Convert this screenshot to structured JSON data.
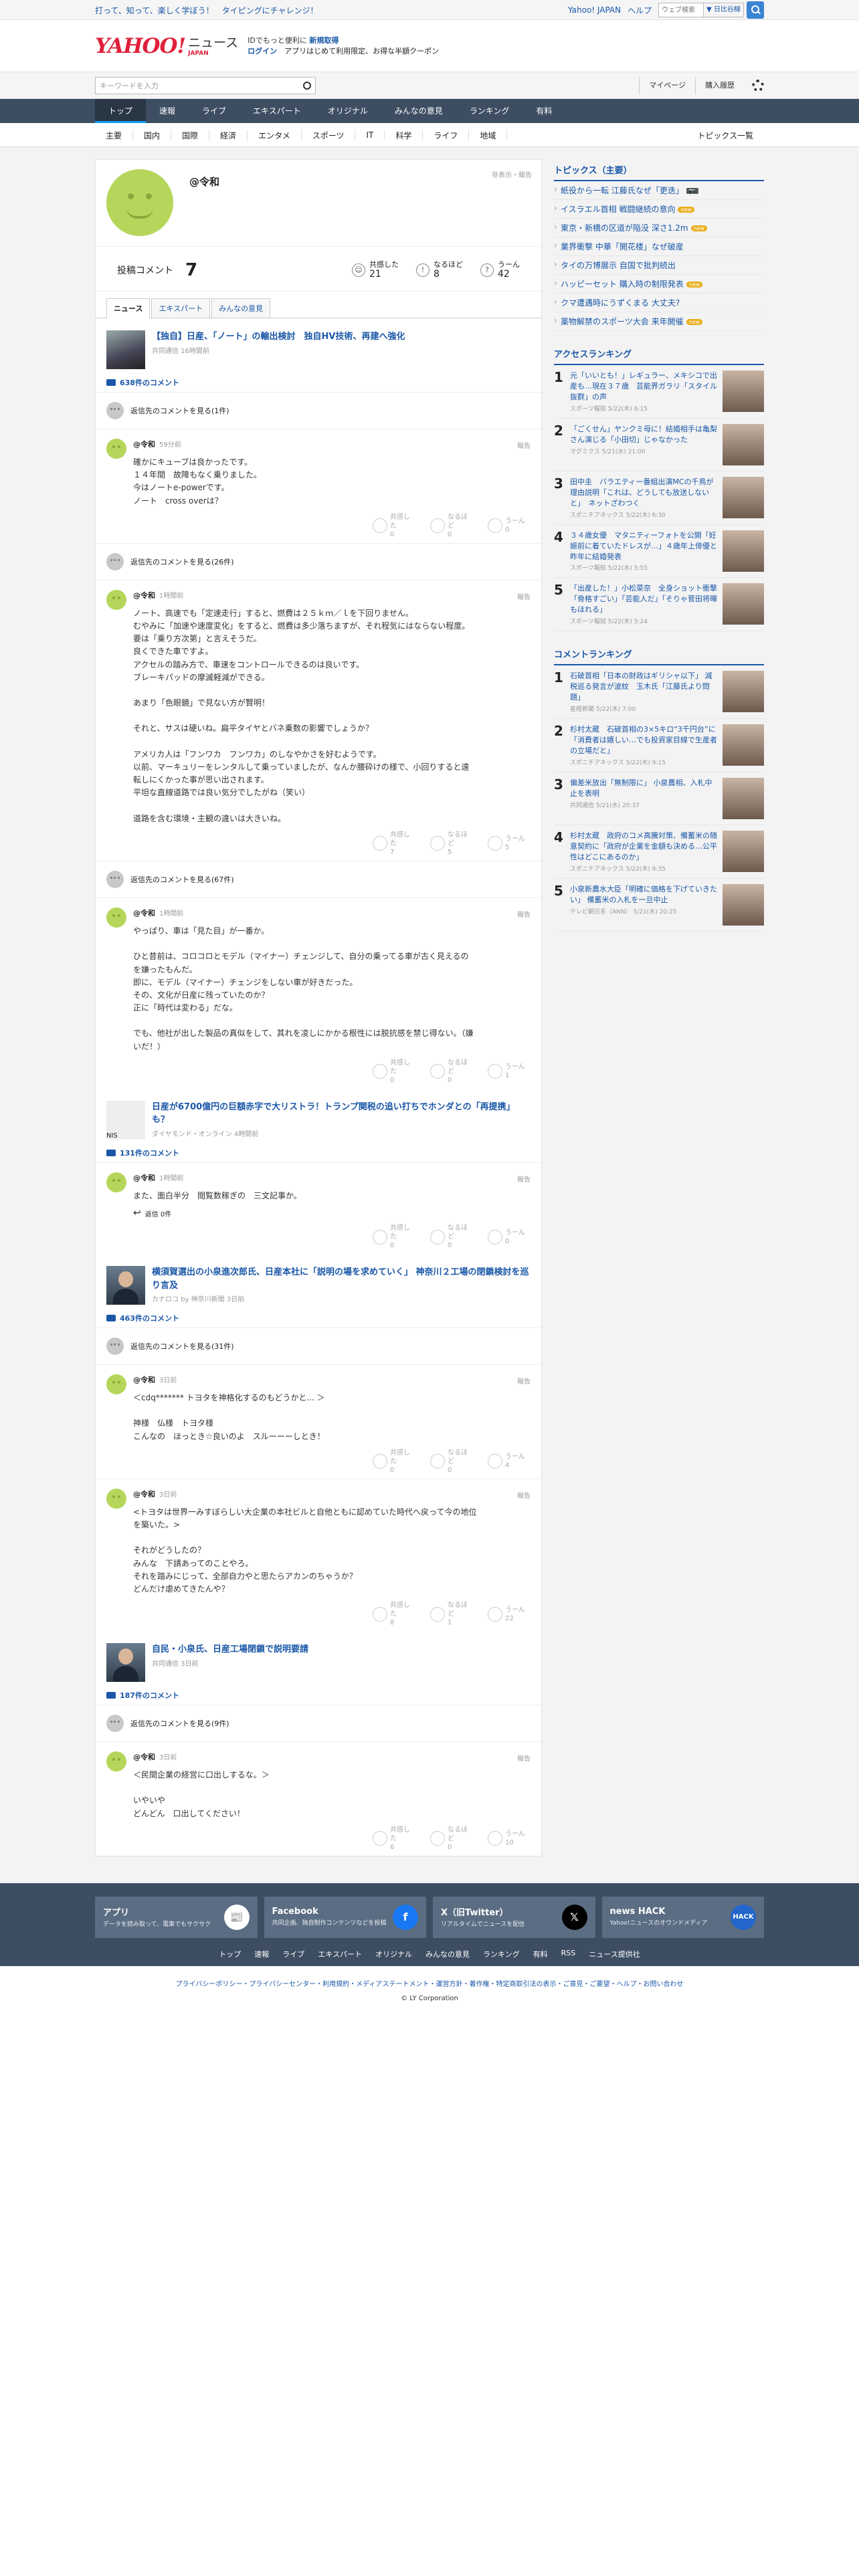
{
  "top": {
    "promo": "打って、知って、楽しく学ぼう！　タイピングにチャレンジ！",
    "links": [
      "Yahoo! JAPAN",
      "ヘルプ"
    ],
    "search_placeholder": "ウェブ検索",
    "selector": "▼ 日比谷線"
  },
  "header": {
    "logo": "YAHOO!",
    "logo_sub": "ニュース",
    "logo_jp": "JAPAN",
    "msg1_a": "IDでもっと便利に",
    "msg1_b": "新規取得",
    "msg2_login": "ログイン",
    "msg2_rest": "　アプリはじめて利用限定、お得な半額クーポン"
  },
  "subbar": {
    "placeholder": "キーワードを入力",
    "mypage": "マイページ",
    "history": "購入履歴"
  },
  "mainnav": [
    "トップ",
    "速報",
    "ライブ",
    "エキスパート",
    "オリジナル",
    "みんなの意見",
    "ランキング",
    "有料"
  ],
  "catnav": [
    "主要",
    "国内",
    "国際",
    "経済",
    "エンタメ",
    "スポーツ",
    "IT",
    "科学",
    "ライフ",
    "地域"
  ],
  "catnav_all": "トピックス一覧",
  "profile": {
    "name": "@令和",
    "hide": "非表示・報告",
    "count_label": "投稿コメント",
    "count": "7",
    "reactions": [
      {
        "label": "共感した",
        "value": "21"
      },
      {
        "label": "なるほど",
        "value": "8"
      },
      {
        "label": "うーん",
        "value": "42"
      }
    ]
  },
  "tabs": [
    "ニュース",
    "エキスパート",
    "みんなの意見"
  ],
  "articles": [
    {
      "title": "【独自】日産、「ノート」の輸出検討　独自HV技術、再建へ強化",
      "source": "共同通信 16時間前",
      "count": "638件のコメント",
      "groups": [
        {
          "replies": "返信先のコメントを見る(1件)",
          "user": "@令和",
          "time": "59分前",
          "report": "報告",
          "text": "確かにキューブは良かったです。\n１４年間　故障もなく乗りました。\n今はノートe-powerです。\nノート　cross overは？",
          "r": [
            "0",
            "0",
            "0"
          ]
        },
        {
          "replies": "返信先のコメントを見る(26件)",
          "user": "@令和",
          "time": "1時間前",
          "report": "報告",
          "text": "ノート、高速でも「定速走行」すると、燃費は２５ｋｍ／ｌを下回りません。\nむやみに「加速や速度変化」をすると、燃費は多少落ちますが、それ程気にはならない程度。\n要は「乗り方次第」と言えそうだ。\n良くできた車ですよ。\nアクセルの踏み方で、車速をコントロールできるのは良いです。\nブレーキパッドの摩滅軽減ができる。\n\nあまり「色眼鏡」で見ない方が賢明！\n\nそれと、サスは硬いね。扁平タイヤとバネ乗数の影響でしょうか？\n\nアメリカ人は「フンワカ　フンワカ」のしなやかさを好むようです。\n以前、マーキュリーをレンタルして乗っていましたが、なんか腰砕けの様で、小回りすると遠\n転しにくかった事が思い出されます。\n平坦な直線道路では良い気分でしたがね（笑い）\n\n道路を含む環境・主観の違いは大きいね。",
          "r": [
            "7",
            "5",
            "5"
          ]
        },
        {
          "replies": "返信先のコメントを見る(67件)",
          "user": "@令和",
          "time": "1時間前",
          "report": "報告",
          "text": "やっぱり、車は「見た目」が一番か。\n\nひと昔前は、コロコロとモデル（マイナー）チェンジして、自分の乗ってる車が古く見えるの\nを嫌ったもんだ。\n即に、モデル（マイナー）チェンジをしない車が好きだった。\nその、文化が日産に残っていたのか？\n正に「時代は変わる」だな。\n\nでも、他社が出した製品の真似をして、其れを凌しにかかる根性には脱抗感を禁じ得ない。（嫌\nいだ！）",
          "r": [
            "0",
            "0",
            "1"
          ]
        }
      ]
    },
    {
      "title": "日産が6700億円の巨額赤字で大リストラ！トランプ関税の追い打ちでホンダとの「再提携」も？",
      "source": "ダイヤモンド・オンライン 4時間前",
      "count": "131件のコメント",
      "thumb_label": "NIS",
      "groups": [
        {
          "replies": "",
          "user": "@令和",
          "time": "1時間前",
          "report": "報告",
          "text": "また、面白半分　閲覧数稼ぎの　三文記事か。",
          "r": [
            "0",
            "0",
            "0"
          ],
          "reply0": "返信 0件"
        }
      ]
    },
    {
      "title": "横須賀選出の小泉進次郎氏、日産本社に「説明の場を求めていく」 神奈川２工場の閉鎖検討を巡り言及",
      "source": "カナロコ by 神奈川新聞 3日前",
      "count": "463件のコメント",
      "groups": [
        {
          "replies": "返信先のコメントを見る(31件)",
          "user": "@令和",
          "time": "3日前",
          "report": "報告",
          "text": "＜cdq******* トヨタを神格化するのもどうかと... ＞\n\n神様　仏様　トヨタ様\nこんなの　ほっとき☆良いのよ　スルーーーしとき！",
          "r": [
            "0",
            "0",
            "4"
          ]
        },
        {
          "replies": "",
          "user": "@令和",
          "time": "3日前",
          "report": "報告",
          "text": "<トヨタは世界一みすぼらしい大企業の本社ビルと自他ともに認めていた時代へ戻って今の地位\nを築いた。>\n\nそれがどうしたの？\nみんな　下請あってのことやろ。\nそれを踏みにじって、全部自力やと思たらアカンのちゃうか？\nどんだけ虐めてきたんや？",
          "r": [
            "8",
            "1",
            "22"
          ]
        }
      ]
    },
    {
      "title": "自民・小泉氏、日産工場閉鎖で説明要請",
      "source": "共同通信 3日前",
      "count": "187件のコメント",
      "groups": [
        {
          "replies": "返信先のコメントを見る(9件)",
          "user": "@令和",
          "time": "3日前",
          "report": "報告",
          "text": "＜民間企業の経営に口出しするな。＞\n\nいやいや\nどんどん　口出してください！",
          "r": [
            "6",
            "0",
            "10"
          ]
        }
      ]
    }
  ],
  "reaction_labels": [
    "共感した",
    "なるほど",
    "うーん"
  ],
  "sidebar": {
    "topics_title": "トピックス（主要）",
    "topics": [
      {
        "t": "紙役から一転 江藤氏なぜ「更迭」",
        "b": "📷"
      },
      {
        "t": "イスラエル首相 戦闘継続の意向",
        "b": "new"
      },
      {
        "t": "東京・新橋の区道が陥没 深さ1.2m",
        "b": "new"
      },
      {
        "t": "業界衝撃 中華「開花楼」なぜ破産",
        "b": ""
      },
      {
        "t": "タイの万博展示 自国で批判続出",
        "b": ""
      },
      {
        "t": "ハッピーセット 購入時の制限発表",
        "b": "new"
      },
      {
        "t": "クマ遭遇時にうずくまる 大丈夫?",
        "b": ""
      },
      {
        "t": "薬物解禁のスポーツ大会 来年開催",
        "b": "new"
      }
    ],
    "access_title": "アクセスランキング",
    "access": [
      {
        "n": "1",
        "t": "元「いいとも！」レギュラー、メキシコで出産も…現在３７歳　芸能界ガラリ「スタイル抜群」の声",
        "s": "スポーツ報知 5/22(木) 6:15"
      },
      {
        "n": "2",
        "t": "「ごくせん」ヤンクミ母に！結婚相手は亀梨さん演じる「小田切」じゃなかった",
        "s": "マグミクス 5/21(水) 21:00"
      },
      {
        "n": "3",
        "t": "田中圭　バラエティー番組出演MCの千鳥が理由説明「これは、どうしても放送しないと」　ネットざわつく",
        "s": "スポニチアネックス 5/22(木) 6:30"
      },
      {
        "n": "4",
        "t": "３４歳女優　マタニティーフォトを公開「妊娠前に着ていたドレスが…」４歳年上俳優と昨年に結婚発表",
        "s": "スポーツ報知 5/22(木) 5:55"
      },
      {
        "n": "5",
        "t": "「出産した！」小松菜奈　全身ショット衝撃「骨格すごい」「芸能人だ」「そりゃ菅田将暉もほれる」",
        "s": "スポーツ報知 5/22(木) 5:24"
      }
    ],
    "comment_title": "コメントランキング",
    "comment": [
      {
        "n": "1",
        "t": "石破首相「日本の財政はギリシャ以下」 減税巡る発言が波紋　玉木氏「江藤氏より問題」",
        "s": "産経新聞 5/22(木) 7:00"
      },
      {
        "n": "2",
        "t": "杉村太蔵　石破首相の3×5キロ“3千円台”に「消費者は嬉しい…でも投資家目線で生産者の立場だと」",
        "s": "スポニチアネックス 5/22(木) 9:15"
      },
      {
        "n": "3",
        "t": "偏差米放出「無制限に」 小泉農相、入札中止を表明",
        "s": "共同通信 5/21(水) 20:37"
      },
      {
        "n": "4",
        "t": "杉村太蔵　政府のコメ高騰対策、備蓄米の随意契約に「政府が企業を金額も決める…公平性はどこにあるのか」",
        "s": "スポニチアネックス 5/22(木) 9:35"
      },
      {
        "n": "5",
        "t": "小泉新農水大臣「明確に価格を下げていきたい」 備蓄米の入札を一旦中止",
        "s": "テレビ朝日系（ANN） 5/21(水) 20:25"
      }
    ]
  },
  "footer": {
    "apps": [
      {
        "h": "アプリ",
        "d": "データを読み取って、電車でもサクサク",
        "ic": "📰"
      },
      {
        "h": "Facebook",
        "d": "共同企画、独自制作コンテンツなどを投稿",
        "ic": "f"
      },
      {
        "h": "X（旧Twitter）",
        "d": "リアルタイムでニュースを配信",
        "ic": "𝕏"
      },
      {
        "h": "news HACK",
        "d": "Yahoo!ニュースのオウンドメディア",
        "ic": "HACK"
      }
    ],
    "links": [
      "トップ",
      "速報",
      "ライブ",
      "エキスパート",
      "オリジナル",
      "みんなの意見",
      "ランキング",
      "有料",
      "RSS",
      "ニュース提供社"
    ],
    "legal": "プライバシーポリシー・プライバシーセンター・利用規約・メディアステートメント・運営方針・著作権・特定商取引法の表示・ご意見・ご要望・ヘルプ・お問い合わせ",
    "copy": "© LY Corporation"
  }
}
